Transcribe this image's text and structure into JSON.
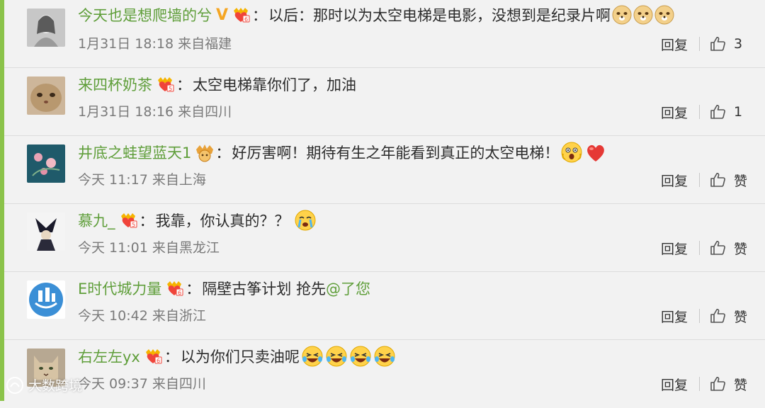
{
  "comments": [
    {
      "username": "今天也是想爬墙的兮",
      "text": "以后：那时以为太空电梯是电影，没想到是纪录片啊",
      "time": "1月31日 18:18",
      "location": "来自福建",
      "reply_label": "回复",
      "like_label": "3",
      "avatar": "avatar-girl",
      "badge": "vip-heart-badge",
      "verified": "V",
      "emoji": [
        "doge-icon",
        "doge-icon",
        "doge-icon"
      ]
    },
    {
      "username": "来四杯奶茶",
      "text": "太空电梯靠你们了，加油",
      "time": "1月31日 18:16",
      "location": "来自四川",
      "reply_label": "回复",
      "like_label": "1",
      "avatar": "avatar-cat",
      "badge": "vip-heart-badge",
      "emoji": []
    },
    {
      "username": "井底之蛙望蓝天1",
      "text": "好厉害啊！期待有生之年能看到真正的太空电梯！",
      "time": "今天 11:17",
      "location": "来自上海",
      "reply_label": "回复",
      "like_label": "赞",
      "avatar": "avatar-flowers",
      "badge": "vip-crown-badge",
      "emoji": [
        "shocked-face-icon",
        "red-heart-icon"
      ]
    },
    {
      "username": "慕九_",
      "text": "我靠，你认真的？？",
      "time": "今天 11:01",
      "location": "来自黑龙江",
      "reply_label": "回复",
      "like_label": "赞",
      "avatar": "avatar-figure",
      "badge": "vip-heart-badge",
      "emoji": [
        "crying-face-icon"
      ]
    },
    {
      "username": "E时代城力量",
      "text": "隔壁古筝计划 抢先",
      "mention": "@了您",
      "time": "今天 10:42",
      "location": "来自浙江",
      "reply_label": "回复",
      "like_label": "赞",
      "avatar": "avatar-city-logo",
      "badge": "vip-heart-badge",
      "emoji": []
    },
    {
      "username": "右左左yx",
      "text": "以为你们只卖油呢",
      "time": "今天 09:37",
      "location": "来自四川",
      "reply_label": "回复",
      "like_label": "赞",
      "avatar": "avatar-cat2",
      "badge": "vip-heart-badge",
      "emoji": [
        "laughing-tears-icon",
        "laughing-tears-icon",
        "laughing-tears-icon",
        "laughing-tears-icon"
      ]
    }
  ],
  "watermark": "大数跨境",
  "colors": {
    "username": "#5f9e3a",
    "accent_bar": "#8bc34a",
    "background": "#f2f2f2"
  }
}
